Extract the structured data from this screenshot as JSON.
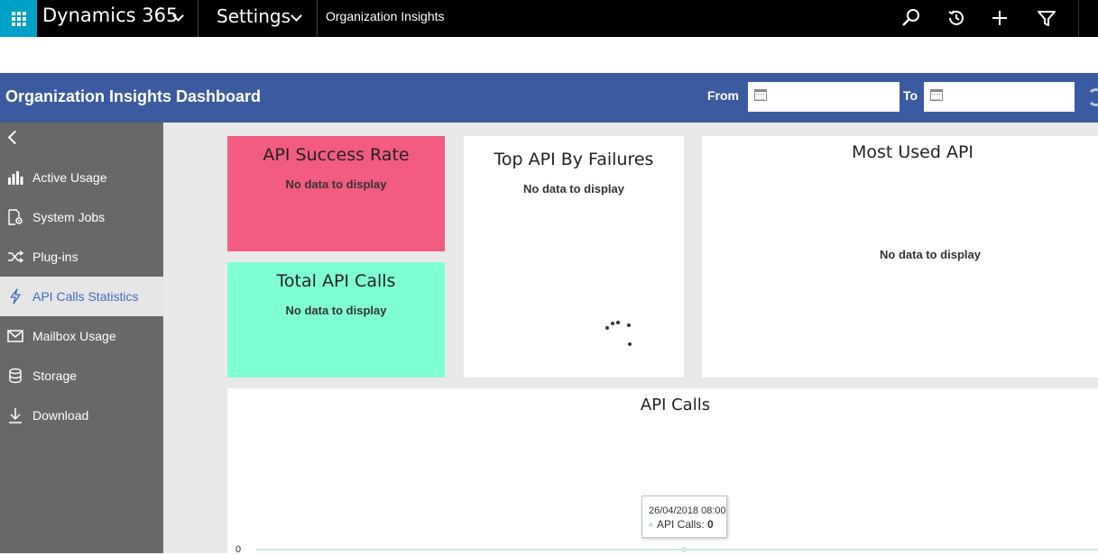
{
  "topbar": {
    "app_name": "Dynamics 365",
    "area": "Settings",
    "breadcrumb": "Organization Insights",
    "icons": [
      "search-icon",
      "history-icon",
      "plus-icon",
      "filter-icon"
    ]
  },
  "header": {
    "title": "Organization Insights Dashboard",
    "from_label": "From",
    "to_label": "To",
    "from_value": "",
    "to_value": ""
  },
  "sidebar": {
    "items": [
      {
        "label": "Active Usage",
        "icon": "bar-chart-icon"
      },
      {
        "label": "System Jobs",
        "icon": "document-gear-icon"
      },
      {
        "label": "Plug-ins",
        "icon": "shuffle-icon"
      },
      {
        "label": "API Calls Statistics",
        "icon": "lightning-icon",
        "active": true
      },
      {
        "label": "Mailbox Usage",
        "icon": "envelope-icon"
      },
      {
        "label": "Storage",
        "icon": "database-icon"
      },
      {
        "label": "Download",
        "icon": "download-icon"
      }
    ]
  },
  "tiles": {
    "success_rate": {
      "title": "API Success Rate",
      "message": "No data to display"
    },
    "total_calls": {
      "title": "Total API Calls",
      "message": "No data to display"
    },
    "top_failures": {
      "title": "Top API By Failures",
      "message": "No data to display"
    },
    "most_used": {
      "title": "Most Used API",
      "message": "No data to display"
    },
    "api_calls": {
      "title": "API Calls",
      "y_tick": "0",
      "tooltip_date": "26/04/2018 08:00",
      "tooltip_series": "API Calls:",
      "tooltip_value": "0"
    }
  },
  "colors": {
    "topbar": "#000000",
    "waffle": "#00a1c7",
    "header": "#3b5ba0",
    "sidebar": "#686868",
    "success_tile": "#f25c80",
    "total_tile": "#7fffd4",
    "active_text": "#3b6ec0"
  }
}
